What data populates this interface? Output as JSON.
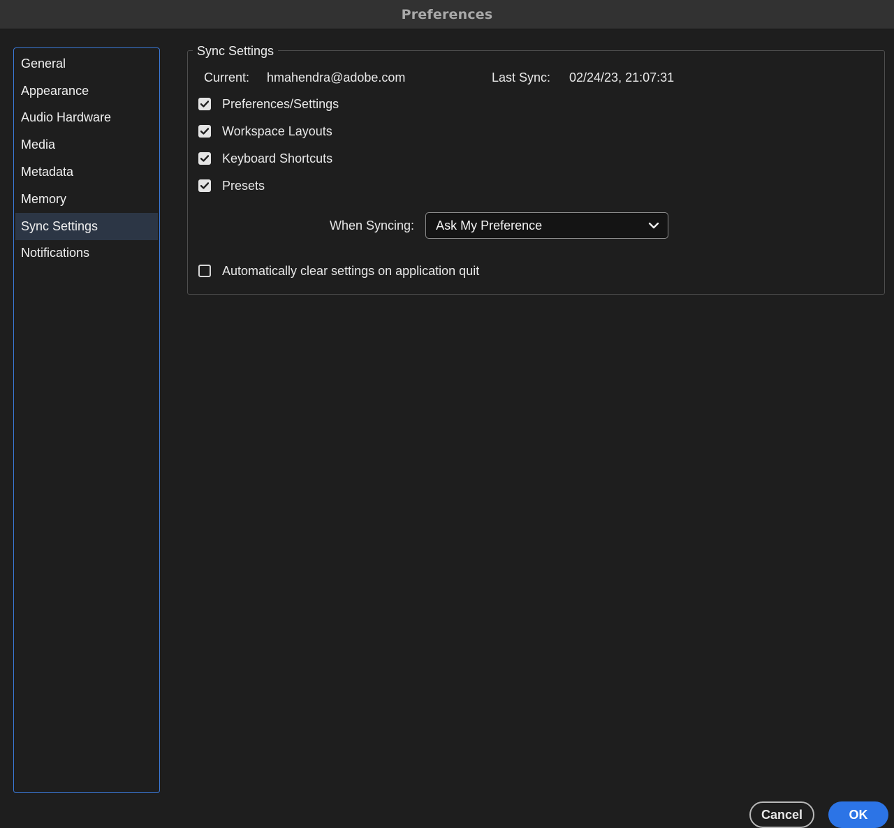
{
  "window": {
    "title": "Preferences"
  },
  "sidebar": {
    "items": [
      {
        "label": "General",
        "selected": false
      },
      {
        "label": "Appearance",
        "selected": false
      },
      {
        "label": "Audio Hardware",
        "selected": false
      },
      {
        "label": "Media",
        "selected": false
      },
      {
        "label": "Metadata",
        "selected": false
      },
      {
        "label": "Memory",
        "selected": false
      },
      {
        "label": "Sync Settings",
        "selected": true
      },
      {
        "label": "Notifications",
        "selected": false
      }
    ]
  },
  "sync_settings": {
    "group_title": "Sync Settings",
    "current_label": "Current:",
    "current_account": "hmahendra@adobe.com",
    "last_sync_label": "Last Sync:",
    "last_sync_value": "02/24/23, 21:07:31",
    "options": [
      {
        "label": "Preferences/Settings",
        "checked": true
      },
      {
        "label": "Workspace Layouts",
        "checked": true
      },
      {
        "label": "Keyboard Shortcuts",
        "checked": true
      },
      {
        "label": "Presets",
        "checked": true
      }
    ],
    "when_syncing_label": "When Syncing:",
    "when_syncing_value": "Ask My Preference",
    "auto_clear": {
      "label": "Automatically clear settings on application quit",
      "checked": false
    }
  },
  "footer": {
    "cancel_label": "Cancel",
    "ok_label": "OK"
  },
  "colors": {
    "accent": "#2c74e6",
    "sidebar_border": "#3a78d6",
    "selected_bg": "#2c3645",
    "background": "#1e1e1e"
  },
  "icons": {
    "checkbox_checked": "checkmark-icon",
    "dropdown": "chevron-down-icon"
  }
}
